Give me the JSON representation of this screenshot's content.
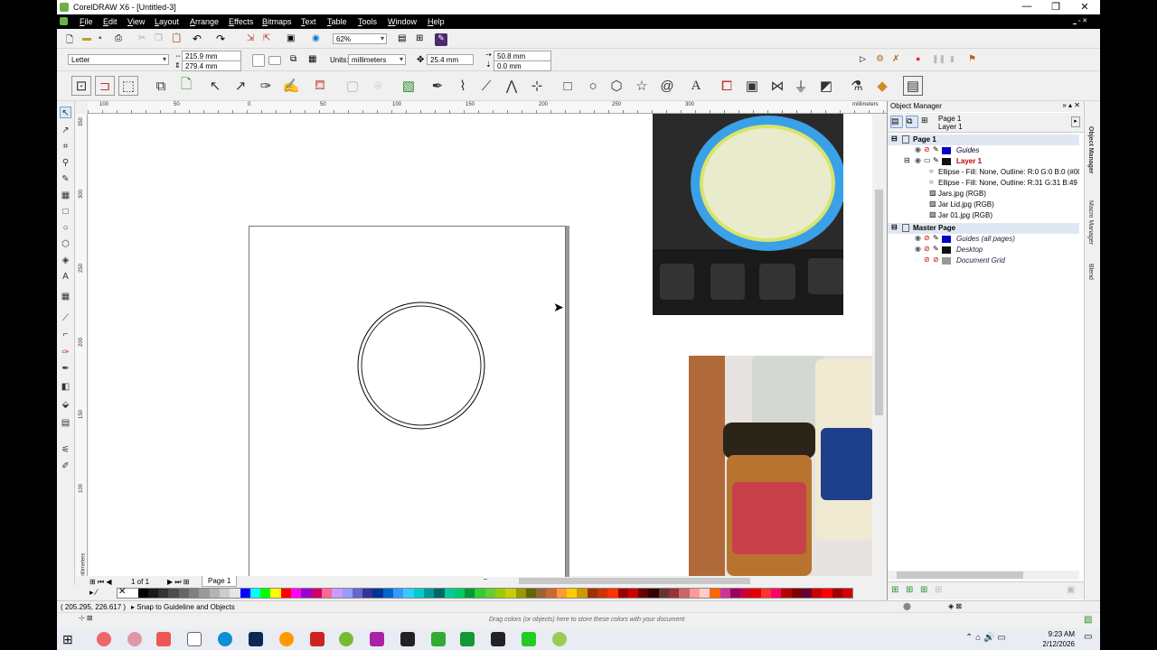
{
  "window": {
    "title": "CorelDRAW X6 - [Untitled-3]",
    "min": "—",
    "max": "❐",
    "close": "✕"
  },
  "menu": [
    "File",
    "Edit",
    "View",
    "Layout",
    "Arrange",
    "Effects",
    "Bitmaps",
    "Text",
    "Table",
    "Tools",
    "Window",
    "Help"
  ],
  "standard_toolbar": {
    "zoom": "62%"
  },
  "property_bar": {
    "paper": "Letter",
    "width": "215.9 mm",
    "height": "279.4 mm",
    "units_label": "Units:",
    "units": "millimeters",
    "nudge": "25.4 mm",
    "dup_x": "50.8 mm",
    "dup_y": "0.0 mm"
  },
  "ruler": {
    "h_ticks": [
      "100",
      "50",
      "0",
      "50",
      "100",
      "150",
      "200",
      "250",
      "300"
    ],
    "v_ticks": [
      "350",
      "300",
      "250",
      "200",
      "150",
      "100"
    ],
    "h_unit": "millimeters",
    "v_unit": "millimeters"
  },
  "page_nav": {
    "count": "1 of 1",
    "tab": "Page 1"
  },
  "palette": [
    "#ffffff",
    "#000000",
    "#1a1a1a",
    "#333333",
    "#4d4d4d",
    "#666666",
    "#808080",
    "#999999",
    "#b3b3b3",
    "#cccccc",
    "#e6e6e6",
    "#0000ff",
    "#00ffff",
    "#00ff00",
    "#ffff00",
    "#ff0000",
    "#ff00ff",
    "#9900cc",
    "#cc0066",
    "#ff6699",
    "#cc99ff",
    "#9999ff",
    "#6666cc",
    "#333399",
    "#003399",
    "#0066cc",
    "#3399ff",
    "#33ccff",
    "#00cccc",
    "#009999",
    "#006666",
    "#00cc99",
    "#00cc66",
    "#009933",
    "#33cc33",
    "#66cc33",
    "#99cc00",
    "#cccc00",
    "#999900",
    "#666600",
    "#996633",
    "#cc6633",
    "#ff9933",
    "#ffcc00",
    "#cc9900",
    "#993300",
    "#cc3300",
    "#ff3300",
    "#990000",
    "#cc0000",
    "#660000",
    "#330000",
    "#663333",
    "#993333",
    "#cc6666",
    "#ff9999",
    "#ffcccc",
    "#ff6600",
    "#cc3399",
    "#990066",
    "#cc0033",
    "#e60000",
    "#ff3333",
    "#ff0066",
    "#b30000",
    "#800000",
    "#660033",
    "#cc0000",
    "#ff0000",
    "#a00000",
    "#d40000"
  ],
  "status": {
    "coords": "( 205.295, 226.617 )",
    "snap": "Snap to Guideline and Objects",
    "palette_hint": "Drag colors (or objects) here to store these colors with your document"
  },
  "object_manager": {
    "title": "Object Manager",
    "current_page": "Page 1",
    "current_layer": "Layer 1",
    "page1": "Page 1",
    "guides": "Guides",
    "layer1": "Layer 1",
    "items": [
      "Ellipse - Fill: None, Outline: R:0 G:0 B:0 (#000",
      "Ellipse - Fill: None, Outline: R:31 G:31 B:49 (#",
      "Jars.jpg (RGB)",
      "Jar Lid.jpg (RGB)",
      "Jar 01.jpg (RGB)"
    ],
    "master_page": "Master Page",
    "guides_all": "Guides (all pages)",
    "desktop": "Desktop",
    "document_grid": "Document Grid"
  },
  "side_tabs": [
    "Object Manager",
    "Macro Manager",
    "Blend"
  ],
  "taskbar": {
    "time": "9:23 AM",
    "date": "2/12/2026"
  },
  "colors": {
    "layer_red": "#c00000",
    "guides_blue": "#0000cc",
    "accent": "#0078d7"
  }
}
